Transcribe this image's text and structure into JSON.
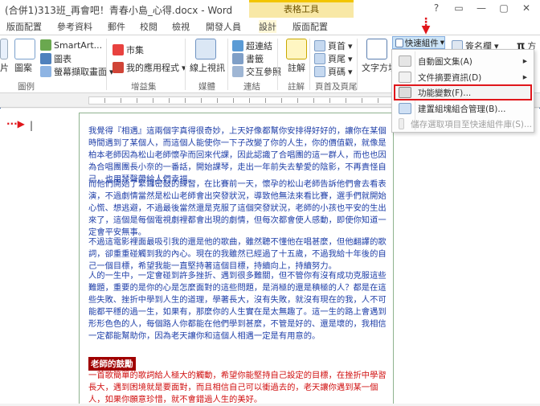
{
  "window": {
    "title": "(合併1)313班_再會吧！青春小島_心得.docx - Word",
    "tool_header": "表格工具",
    "controls": [
      "?",
      "▭",
      "—",
      "▢",
      "✕"
    ]
  },
  "tabs": [
    "版面配置",
    "參考資料",
    "郵件",
    "校閱",
    "檢視",
    "開發人員",
    "設計",
    "版面配置"
  ],
  "ribbon": {
    "illustrations": {
      "picture_partial": "片",
      "shapes": "圖案",
      "smartart": "SmartArt...",
      "chart": "圖表",
      "screenshot": "螢幕擷取畫面",
      "group": "圖例"
    },
    "addins": {
      "store": "市集",
      "my_apps": "我的應用程式",
      "group": "增益集"
    },
    "media": {
      "online_video": "線上視訊",
      "group": "媒體"
    },
    "links": {
      "hyperlink": "超連結",
      "bookmark": "書籤",
      "cross_ref": "交互參照",
      "group": "連結"
    },
    "comments": {
      "comment": "註解",
      "group": "註解"
    },
    "header_footer": {
      "header": "頁首",
      "footer": "頁尾",
      "page_number": "頁碼",
      "group": "頁首及頁尾"
    },
    "text": {
      "text_box": "文字方塊"
    },
    "quick_parts": "快速組件",
    "signature": "簽名欄",
    "equation_partial": "方"
  },
  "menu": {
    "items": [
      {
        "label": "自動圖文集(A)",
        "disabled": false,
        "submenu": true
      },
      {
        "label": "文件摘要資訊(D)",
        "disabled": false,
        "submenu": true
      },
      {
        "label": "功能變數(F)...",
        "disabled": false,
        "submenu": false,
        "highlighted": true
      },
      {
        "label": "建置組塊組合管理(B)...",
        "disabled": false,
        "submenu": false
      },
      {
        "label": "儲存選取項目至快速組件庫(S)...",
        "disabled": true,
        "submenu": false
      }
    ]
  },
  "document": {
    "paragraphs_blue": [
      "我覺得『相遇』這兩個字真得很奇妙，上天好像都幫你安排得好好的，讓你在某個時間遇到了某個人，而這個人能使你一下子改變了你的人生，你的價值觀，就像是柏本老師因為松山老師懷孕而回來代課，因此認識了合唱團的這一群人，而也也因為合唱團團長小奈的一番話，開始課琴，走出一年前失去摯愛的陰影，不再責怪自己，也用琴聲帶給人們幸福。",
      "而他們開始了緊鑼密鼓的練習，在比賽前一天，懷孕的松山老師告訴他們會去看表演，不過劇情當然是松山老師會出突發狀況，導致他無法來看比賽，選手們就開始心慌、想逃避，不過最後當然還是克服了這個突發狀況，老師的小孩也平安的生出來了，這個是每個電視劇裡都會出現的劇情，但每次都會使人感動，即使你知道一定會平安無事。",
      "不過這電影裡面最吸引我的還是他的歌曲，雖然聽不懂他在唱甚麼，但他翻譯的歌詞，卻重重碰觸到我的內心。現在的我雖然已經過了十五歲，不過我給十年後的自己一個目標，希望我能一直堅持著這個目標，持續向上，持續努力。",
      "人的一生中，一定會碰到許多挫折、遇到很多難關，但不管你有沒有成功克服這些難題，重要的是你的心是怎麼面對的這些問題，是消極的還是積極的人？都是在這些失敗、挫折中學到人生的道理，學著長大，沒有失敗，就沒有現在的我，人不可能都平穩的過一生，如果有，那麼你的人生實在是太無趣了。這一生的路上會遇到形形色色的人，每個路人你都能在他們學到甚麼，不管是好的、還是壞的，我相信一定都能幫助你，因為老天讓你和這個人相遇一定是有用意的。"
    ],
    "heading": "老師的鼓勵",
    "paragraph_red": "一首歌簡單的歌詞給人極大的觸動，希望你能堅持自己設定的目標，在挫折中學習長大，遇到困境就是要面對，而且相信自己可以衝過去的，老天讓你遇到某一個人，如果你願意珍惜，就不會錯過人生的美好。"
  },
  "colors": {
    "accent": "#2b579a",
    "tool_header": "#f8e8a6",
    "doc_text_blue": "#1f3fa8",
    "doc_text_red": "#d01010",
    "highlight_box": "#e0161b",
    "heading_bg": "#a00000"
  }
}
